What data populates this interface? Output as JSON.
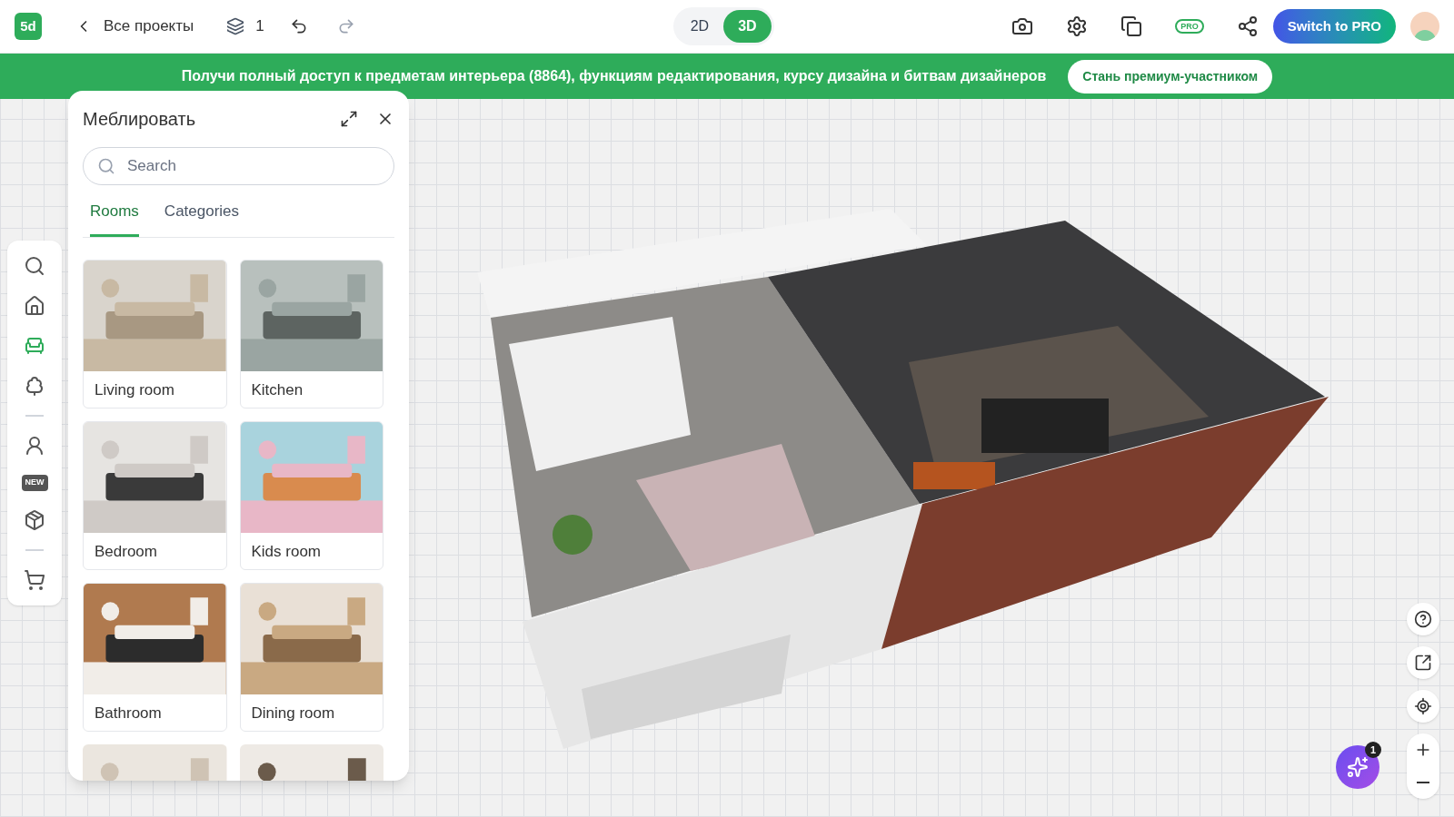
{
  "header": {
    "logo": "5d",
    "back": "Все проекты",
    "floors": "1",
    "view_modes": [
      {
        "label": "2D",
        "selected": false
      },
      {
        "label": "3D",
        "selected": true
      }
    ],
    "pro_badge": "PRO",
    "upgrade_button": "Switch to PRO"
  },
  "banner": {
    "text": "Получи полный доступ к предметам интерьера (8864), функциям редактирования, курсу дизайна и битвам дизайнеров",
    "button": "Стань премиум-участником"
  },
  "toolbar": {
    "items": [
      {
        "kind": "search",
        "selected": false
      },
      {
        "kind": "home",
        "selected": false
      },
      {
        "kind": "furniture",
        "selected": true
      },
      {
        "kind": "tree",
        "selected": false
      },
      {
        "kind": "divider"
      },
      {
        "kind": "person",
        "selected": false
      },
      {
        "kind": "new",
        "label": "NEW",
        "selected": false
      },
      {
        "kind": "package",
        "selected": false
      },
      {
        "kind": "divider"
      },
      {
        "kind": "cart",
        "selected": false
      }
    ]
  },
  "panel": {
    "title": "Меблировать",
    "search": {
      "placeholder": "Search"
    },
    "tabs": [
      {
        "label": "Rooms",
        "selected": true
      },
      {
        "label": "Categories",
        "selected": false
      }
    ],
    "rooms": [
      {
        "kind": "room",
        "label": "Living room"
      },
      {
        "kind": "room",
        "label": "Kitchen"
      },
      {
        "kind": "room",
        "label": "Bedroom"
      },
      {
        "kind": "room",
        "label": "Kids room"
      },
      {
        "kind": "room",
        "label": "Bathroom"
      },
      {
        "kind": "room",
        "label": "Dining room"
      },
      {
        "kind": "partial"
      },
      {
        "kind": "partial"
      }
    ]
  },
  "assistant": {
    "count": "1"
  }
}
